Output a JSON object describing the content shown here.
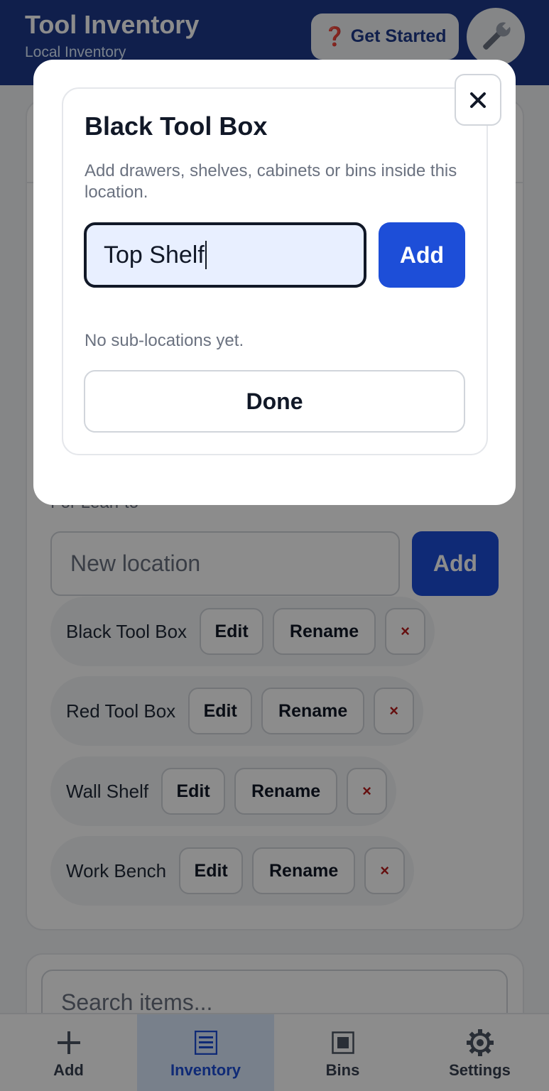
{
  "header": {
    "title": "Tool Inventory",
    "subtitle": "Local Inventory",
    "get_started_label": "Get Started",
    "get_started_icon": "question-icon",
    "settings_icon": "wrench-icon"
  },
  "locations_card": {
    "section_label": "For Lean-to",
    "new_location_placeholder": "New location",
    "add_label": "Add",
    "locations": [
      {
        "name": "Black Tool Box",
        "edit": "Edit",
        "rename": "Rename",
        "delete": "×"
      },
      {
        "name": "Red Tool Box",
        "edit": "Edit",
        "rename": "Rename",
        "delete": "×"
      },
      {
        "name": "Wall Shelf",
        "edit": "Edit",
        "rename": "Rename",
        "delete": "×"
      },
      {
        "name": "Work Bench",
        "edit": "Edit",
        "rename": "Rename",
        "delete": "×"
      }
    ]
  },
  "search": {
    "placeholder": "Search items..."
  },
  "bottom_nav": [
    {
      "label": "Add",
      "icon": "plus-icon",
      "active": false
    },
    {
      "label": "Inventory",
      "icon": "list-icon",
      "active": true
    },
    {
      "label": "Bins",
      "icon": "bin-icon",
      "active": false
    },
    {
      "label": "Settings",
      "icon": "gear-icon",
      "active": false
    }
  ],
  "modal": {
    "title": "Black Tool Box",
    "description": "Add drawers, shelves, cabinets or bins inside this location.",
    "input_value": "Top Shelf",
    "add_label": "Add",
    "empty_message": "No sub-locations yet.",
    "done_label": "Done",
    "close_label": "×"
  },
  "colors": {
    "header_bg": "#1e3a8a",
    "primary": "#1d4ed8",
    "danger": "#b91c1c",
    "active_nav_bg": "#dbeafe"
  }
}
